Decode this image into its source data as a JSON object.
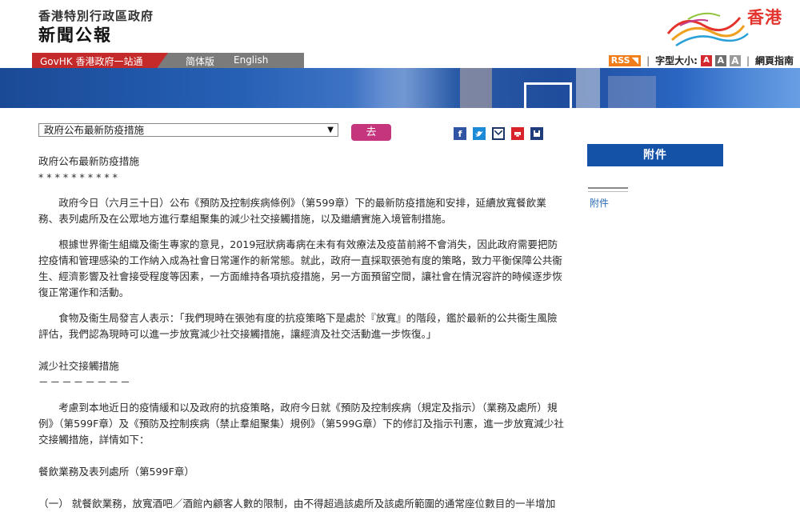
{
  "header": {
    "department": "香港特別行政區政府",
    "publication": "新聞公報",
    "logo_text": "香港"
  },
  "nav": {
    "govhk": "GovHK 香港政府一站通",
    "simplified": "简体版",
    "english": "English",
    "rss": "RSS",
    "font_size_label": "字型大小:",
    "font_sizes": [
      "A",
      "A",
      "A"
    ],
    "help": "網頁指南"
  },
  "toolbar": {
    "select_value": "政府公布最新防疫措施",
    "go_label": "去"
  },
  "share_icons": [
    "facebook-icon",
    "twitter-icon",
    "email-icon",
    "print-icon",
    "save-icon"
  ],
  "colors": {
    "gov_red": "#c52a2a",
    "go_button": "#c4357d",
    "attachment_blue": "#1452a8",
    "link_blue": "#2a6bb5"
  },
  "article": {
    "title": "政府公布最新防疫措施",
    "stars": "**********",
    "paragraph1": "政府今日（六月三十日）公布《預防及控制疾病條例》（第599章）下的最新防疫措施和安排，延續放寬餐飲業務、表列處所及在公眾地方進行羣組聚集的減少社交接觸措施，以及繼續實施入境管制措施。",
    "paragraph2": "根據世界衞生組織及衞生專家的意見，2019冠狀病毒病在未有有效療法及疫苗前將不會消失，因此政府需要把防控疫情和管理感染的工作納入成為社會日常運作的新常態。就此，政府一直採取張弛有度的策略，致力平衡保障公共衞生、經濟影響及社會接受程度等因素，一方面維持各項抗疫措施，另一方面預留空間，讓社會在情況容許的時候逐步恢復正常運作和活動。",
    "paragraph3": "食物及衞生局發言人表示：「我們現時在張弛有度的抗疫策略下是處於『放寬』的階段，鑑於最新的公共衞生風險評估，我們認為現時可以進一步放寬減少社交接觸措施，讓經濟及社交活動進一步恢復。」",
    "subheading": "減少社交接觸措施",
    "dashes": "－－－－－－－－",
    "paragraph4": "考慮到本地近日的疫情緩和以及政府的抗疫策略，政府今日就《預防及控制疾病（規定及指示）（業務及處所）規例》（第599F章）及《預防及控制疾病（禁止羣組聚集）規例》（第599G章）下的修訂及指示刊憲，進一步放寬減少社交接觸措施，詳情如下：",
    "section": "餐飲業務及表列處所（第599F章）",
    "point1": "（一） 就餐飲業務，放寬酒吧／酒館內顧客人數的限制，由不得超過該處所及該處所範圍的通常座位數目的一半增加"
  },
  "sidebar": {
    "attachment_header": "附件",
    "attachment_link": "附件"
  }
}
